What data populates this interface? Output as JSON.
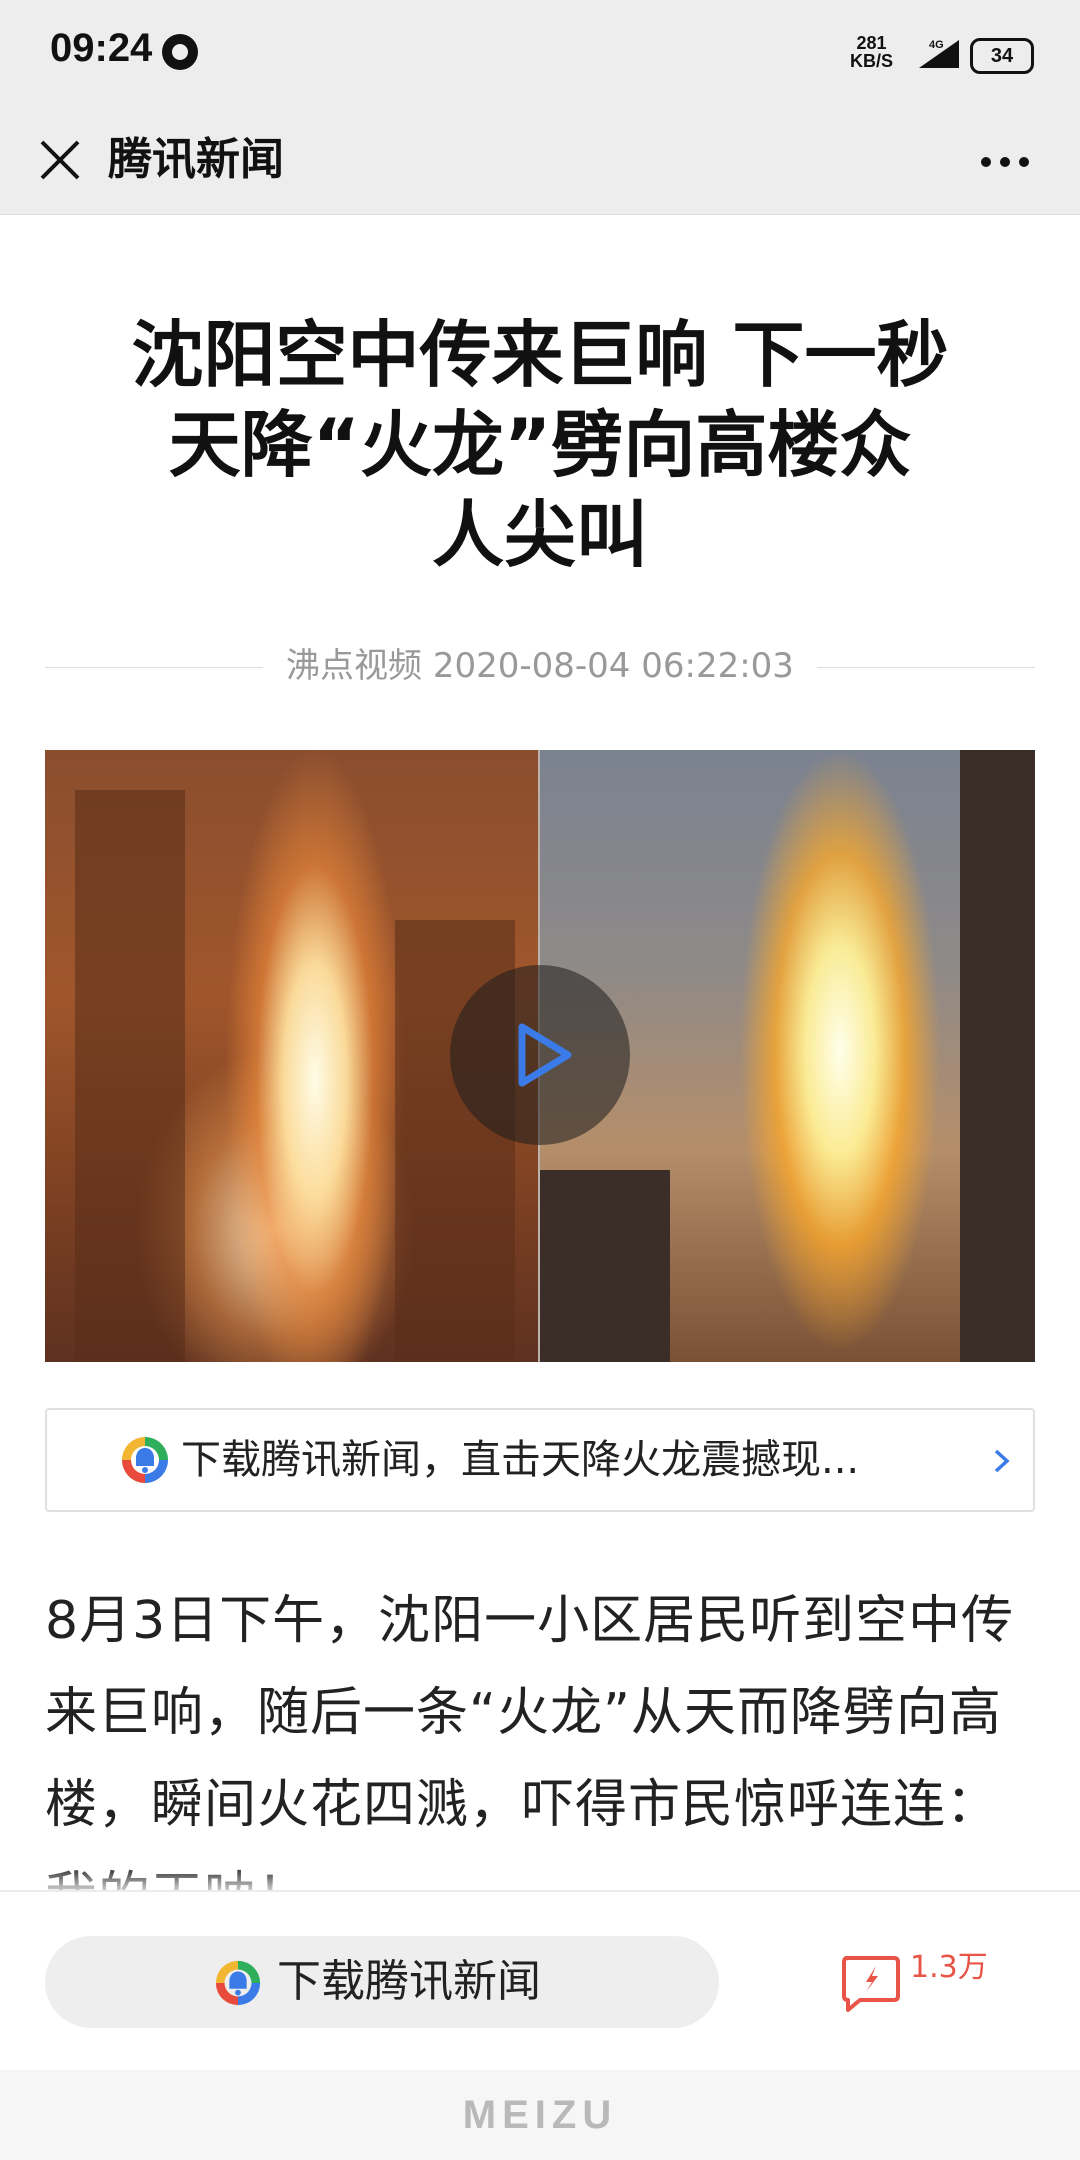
{
  "status_bar": {
    "time": "09:24",
    "net_speed_value": "281",
    "net_speed_unit": "KB/S",
    "network": "4G",
    "battery": "34"
  },
  "nav": {
    "title": "腾讯新闻",
    "close_icon": "close-icon",
    "more_icon": "more-icon"
  },
  "article": {
    "title_lines": [
      "沈阳空中传来巨响 下一秒",
      "天降“火龙”劈向高楼众",
      "人尖叫"
    ],
    "meta": "沸点视频 2020-08-04 06:22:03",
    "body": "8月3日下午，沈阳一小区居民听到空中传来巨响，随后一条“火龙”从天而降劈向高楼，瞬间火花四溅，吓得市民惊呼连连：我的天呐！"
  },
  "video": {
    "play_icon": "play-icon"
  },
  "banner": {
    "text": "下载腾讯新闻，直击天降火龙震撼现...",
    "logo_icon": "tencent-news-logo-icon",
    "arrow_icon": "chevron-right-icon"
  },
  "bottom_bar": {
    "download_label": "下载腾讯新闻",
    "comment_count": "1.3万",
    "comment_icon": "comment-icon"
  },
  "device": {
    "brand": "MEIZU"
  },
  "colors": {
    "accent_blue": "#3b7be8",
    "comment_red": "#e85548",
    "nav_bg": "#ededed"
  }
}
